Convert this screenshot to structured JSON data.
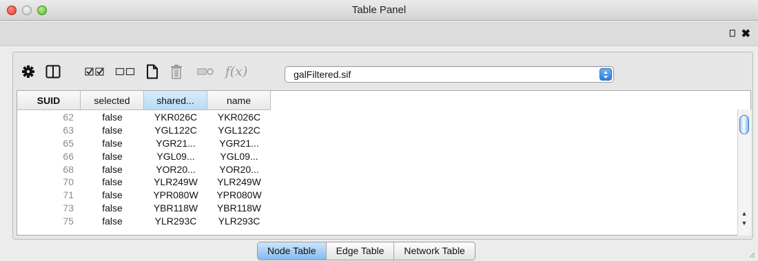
{
  "window": {
    "title": "Table Panel"
  },
  "header": {
    "pin_icon": "pin-icon",
    "close_icon": "close-icon"
  },
  "toolbar": {
    "icons": [
      "gear-icon",
      "columns-icon",
      "select-all-icon",
      "deselect-all-icon",
      "new-column-icon",
      "delete-icon",
      "link-icon"
    ],
    "function_label": "f(x)",
    "table_selector": {
      "selected": "galFiltered.sif"
    }
  },
  "table": {
    "columns": [
      "SUID",
      "selected",
      "shared...",
      "name"
    ],
    "selected_column": "shared...",
    "rows": [
      {
        "suid": "62",
        "selected": "false",
        "shared": "YKR026C",
        "name": "YKR026C"
      },
      {
        "suid": "63",
        "selected": "false",
        "shared": "YGL122C",
        "name": "YGL122C"
      },
      {
        "suid": "65",
        "selected": "false",
        "shared": "YGR21...",
        "name": "YGR21..."
      },
      {
        "suid": "66",
        "selected": "false",
        "shared": "YGL09...",
        "name": "YGL09..."
      },
      {
        "suid": "68",
        "selected": "false",
        "shared": "YOR20...",
        "name": "YOR20..."
      },
      {
        "suid": "70",
        "selected": "false",
        "shared": "YLR249W",
        "name": "YLR249W"
      },
      {
        "suid": "71",
        "selected": "false",
        "shared": "YPR080W",
        "name": "YPR080W"
      },
      {
        "suid": "73",
        "selected": "false",
        "shared": "YBR118W",
        "name": "YBR118W"
      },
      {
        "suid": "75",
        "selected": "false",
        "shared": "YLR293C",
        "name": "YLR293C"
      }
    ]
  },
  "tabs": [
    {
      "label": "Node Table",
      "active": true
    },
    {
      "label": "Edge Table",
      "active": false
    },
    {
      "label": "Network Table",
      "active": false
    }
  ]
}
